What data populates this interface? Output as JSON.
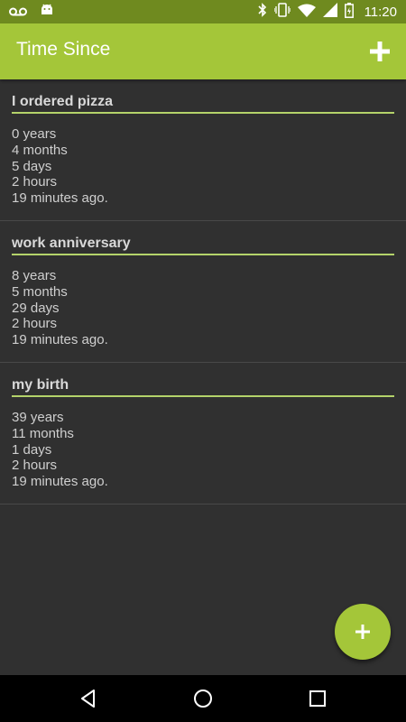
{
  "status_bar": {
    "time": "11:20",
    "icons": [
      "voicemail-icon",
      "android-icon",
      "bluetooth-icon",
      "vibrate-icon",
      "wifi-icon",
      "signal-icon",
      "battery-icon"
    ]
  },
  "app_bar": {
    "title": "Time Since",
    "add_icon": "plus-icon"
  },
  "items": [
    {
      "title": "I ordered pizza",
      "lines": [
        "0 years",
        "4 months",
        "5 days",
        "2 hours",
        "19 minutes ago."
      ]
    },
    {
      "title": "work anniversary",
      "lines": [
        "8 years",
        "5 months",
        "29 days",
        "2 hours",
        "19 minutes ago."
      ]
    },
    {
      "title": "my birth",
      "lines": [
        "39 years",
        "11 months",
        "1 days",
        "2 hours",
        "19 minutes ago."
      ]
    }
  ],
  "fab": {
    "icon": "plus-icon"
  },
  "nav": {
    "icons": [
      "back-icon",
      "home-icon",
      "recents-icon"
    ]
  },
  "colors": {
    "accent": "#a4c639",
    "status_bar": "#6f8a1f",
    "background": "#303030",
    "rule": "#b4d36a"
  }
}
